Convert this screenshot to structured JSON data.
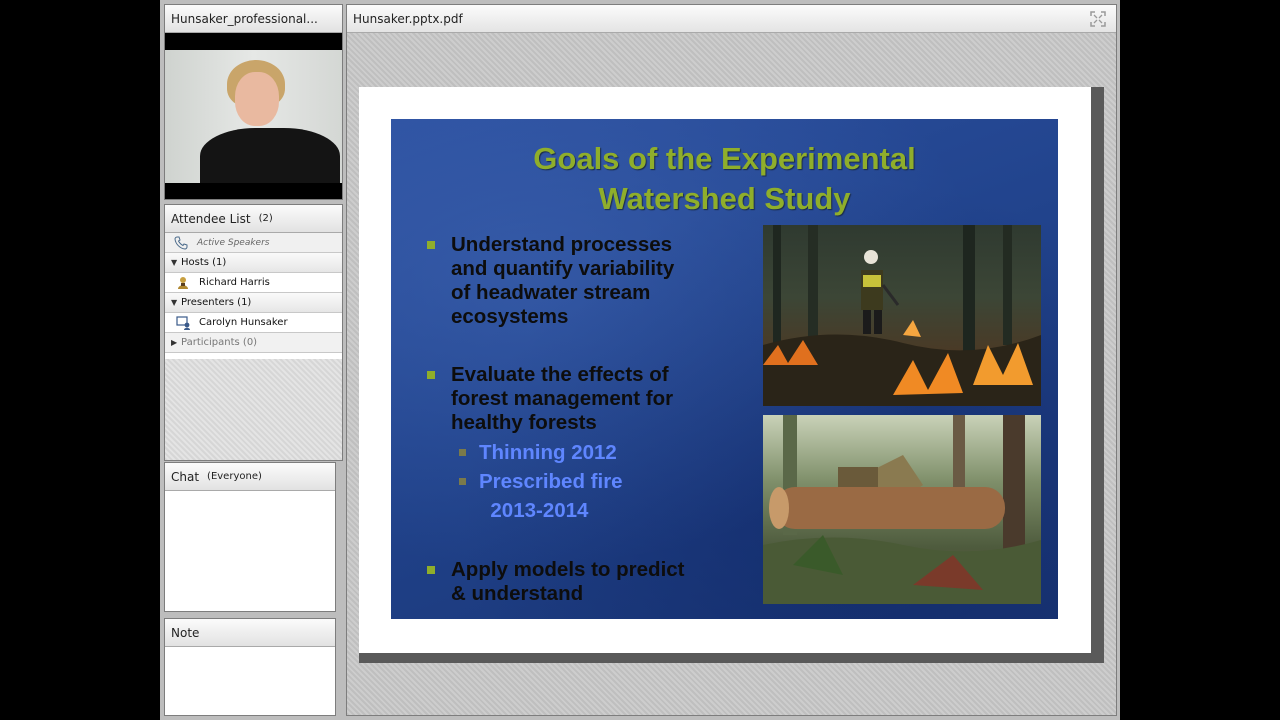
{
  "camera_pod": {
    "title": "Hunsaker_professional..."
  },
  "attendee_pod": {
    "title": "Attendee List",
    "count": "(2)",
    "active_speakers": "Active Speakers",
    "hosts_label": "Hosts (1)",
    "host_name": "Richard Harris",
    "presenters_label": "Presenters (1)",
    "presenter_name": "Carolyn Hunsaker",
    "participants_label": "Participants (0)"
  },
  "chat_pod": {
    "title": "Chat",
    "scope": "(Everyone)"
  },
  "note_pod": {
    "title": "Note"
  },
  "share_pod": {
    "title": "Hunsaker.pptx.pdf"
  },
  "slide": {
    "title_line1": "Goals of the Experimental",
    "title_line2": "Watershed Study",
    "bullet1": "Understand processes\nand quantify variability\nof headwater stream\necosystems",
    "bullet2": "Evaluate the effects of\nforest management for\nhealthy forests",
    "sub1": "Thinning 2012",
    "sub2": "Prescribed fire\n  2013-2014",
    "bullet3": "Apply models to predict\n& understand"
  },
  "colors": {
    "slide_title": "#8fae2b",
    "sub_bullet": "#5f86ff",
    "slide_bg": "#21438c"
  }
}
